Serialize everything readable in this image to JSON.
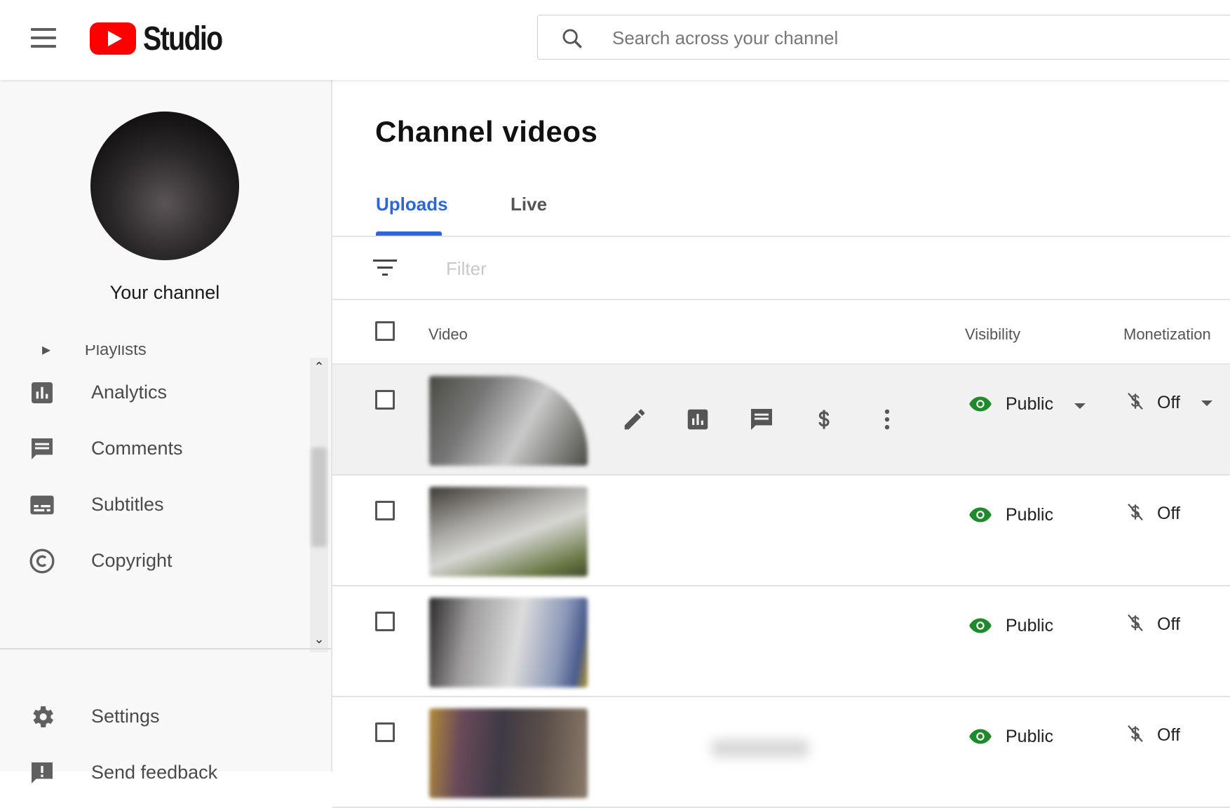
{
  "header": {
    "logo_text": "Studio",
    "search_placeholder": "Search across your channel"
  },
  "sidebar": {
    "channel_label": "Your channel",
    "partial_item_label": "Playlists",
    "items": [
      {
        "label": "Analytics",
        "icon": "analytics-icon"
      },
      {
        "label": "Comments",
        "icon": "comments-icon"
      },
      {
        "label": "Subtitles",
        "icon": "subtitles-icon"
      },
      {
        "label": "Copyright",
        "icon": "copyright-icon"
      }
    ],
    "bottom_items": [
      {
        "label": "Settings",
        "icon": "gear-icon"
      },
      {
        "label": "Send feedback",
        "icon": "feedback-icon"
      }
    ]
  },
  "main": {
    "title": "Channel videos",
    "tabs": [
      {
        "label": "Uploads",
        "active": true
      },
      {
        "label": "Live",
        "active": false
      }
    ],
    "filter_placeholder": "Filter",
    "table": {
      "columns": [
        "Video",
        "Visibility",
        "Monetization"
      ],
      "rows": [
        {
          "visibility": "Public",
          "monetization": "Off",
          "hovered": true
        },
        {
          "visibility": "Public",
          "monetization": "Off",
          "hovered": false
        },
        {
          "visibility": "Public",
          "monetization": "Off",
          "hovered": false
        },
        {
          "visibility": "Public",
          "monetization": "Off",
          "hovered": false
        }
      ]
    }
  },
  "colors": {
    "accent": "#2c67d8",
    "brand_red": "#ff0000",
    "public_green": "#1e8a2c"
  }
}
